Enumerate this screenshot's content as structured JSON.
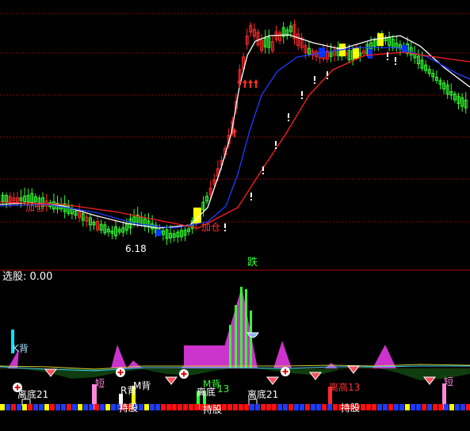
{
  "colors": {
    "background": "#000000",
    "grid": "#8b0000",
    "up": "#ff2a2a",
    "down": "#33ff33",
    "flat": "#ffff00",
    "blue_box": "#0033ff",
    "ma_white": "#ffffff",
    "ma_blue": "#1e3cff",
    "ma_red": "#ff2020",
    "magenta": "#cc33cc",
    "dark_green": "#0f3d0f",
    "text_white": "#ffffff",
    "text_red": "#ff3030",
    "text_green": "#33ff33",
    "text_yellow": "#ffff33",
    "cyan": "#00e5ff",
    "pink": "#ff88dd"
  },
  "top_panel": {
    "low_price_label": "6.18",
    "middle_label": "跌",
    "signal_labels": [
      "加仓",
      "加仓"
    ]
  },
  "indicator_panel": {
    "title": "选股: 0.00",
    "labels": [
      {
        "text": "K背",
        "color": "cyan"
      },
      {
        "text": "离底21",
        "color": "white"
      },
      {
        "text": "短",
        "color": "pink"
      },
      {
        "text": "R背",
        "color": "white"
      },
      {
        "text": "M背",
        "color": "white"
      },
      {
        "text": "离底",
        "color": "white"
      },
      {
        "text": "M背",
        "color": "green"
      },
      {
        "text": "13",
        "color": "green"
      },
      {
        "text": "离底21",
        "color": "white"
      },
      {
        "text": "离高13",
        "color": "red"
      },
      {
        "text": "短",
        "color": "pink"
      },
      {
        "text": "持股",
        "color": "white"
      },
      {
        "text": "持股",
        "color": "white"
      },
      {
        "text": "持股",
        "color": "white"
      }
    ]
  },
  "icons": [
    "plus-circle-icon",
    "diamond-icon",
    "cup-icon",
    "up-arrow-icon",
    "exclamation-icon"
  ]
}
